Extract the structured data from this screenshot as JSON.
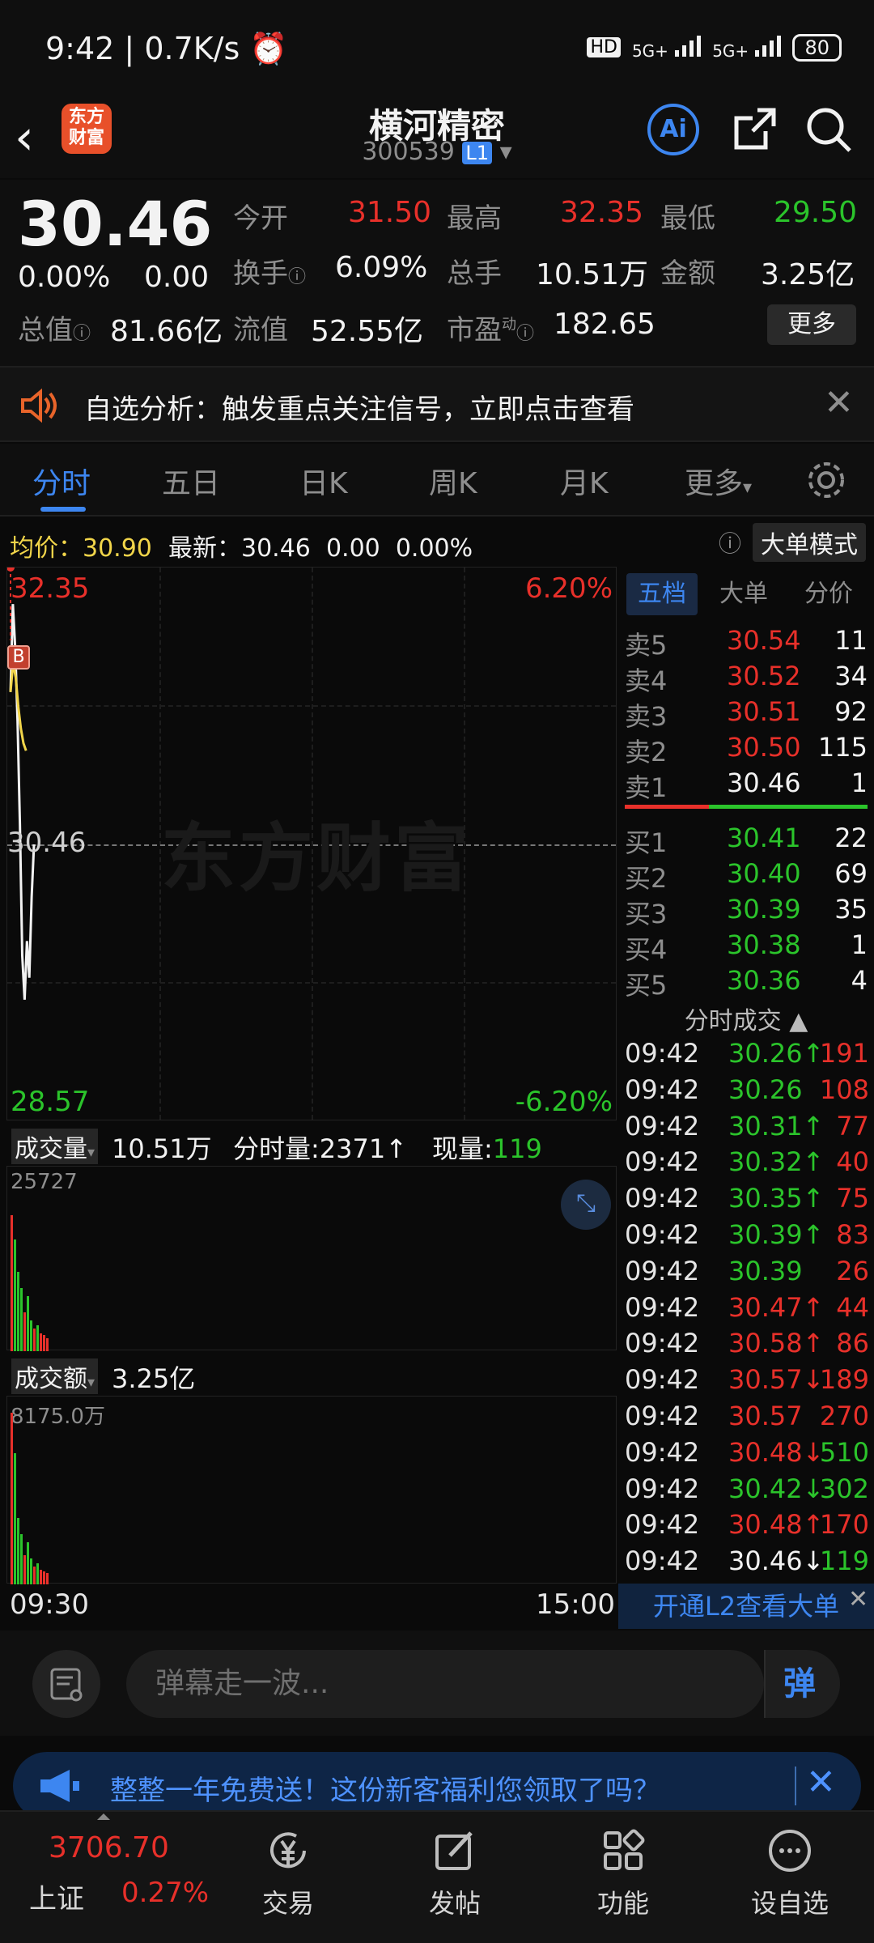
{
  "status_bar": {
    "time": "9:42",
    "speed": "0.7K/s",
    "hd_badge": "HD",
    "net1": "5G+",
    "net2": "5G+",
    "battery": "80"
  },
  "header": {
    "logo_text_top": "东方",
    "logo_text_bottom": "财富",
    "stock_name": "横河精密",
    "stock_code": "300539",
    "level_badge": "L1",
    "ai_label": "Ai"
  },
  "quote": {
    "price": "30.46",
    "change_pct": "0.00%",
    "change_val": "0.00",
    "open_label": "今开",
    "open": "31.50",
    "high_label": "最高",
    "high": "32.35",
    "low_label": "最低",
    "low": "29.50",
    "turnover_label": "换手",
    "turnover": "6.09%",
    "volume_label": "总手",
    "volume": "10.51万",
    "amount_label": "金额",
    "amount": "3.25亿",
    "mktcap_label": "总值",
    "mktcap": "81.66亿",
    "float_label": "流值",
    "float": "52.55亿",
    "pe_label": "市盈",
    "pe_sup": "动",
    "pe": "182.65",
    "more_label": "更多"
  },
  "analysis": {
    "text": "自选分析：触发重点关注信号，立即点击查看"
  },
  "tabs": [
    "分时",
    "五日",
    "日K",
    "周K",
    "月K",
    "更多"
  ],
  "avg": {
    "avg_label": "均价：",
    "avg_value": "30.90",
    "latest_label": "最新：",
    "latest_value": "30.46",
    "chg": "0.00",
    "pct": "0.00%",
    "big_order_mode": "大单模式"
  },
  "chart": {
    "top_price": "32.35",
    "mid_price": "30.46",
    "bottom_price": "28.57",
    "top_pct": "6.20%",
    "bottom_pct": "-6.20%",
    "watermark": "东方财富",
    "marker": "B",
    "time_start": "09:30",
    "time_end": "15:00"
  },
  "chart_data": {
    "type": "line",
    "title": "",
    "ylim": [
      28.57,
      32.35
    ],
    "series": [
      {
        "values": [
          31.5,
          32.1,
          31.8,
          31.3,
          30.6,
          29.7,
          29.4,
          29.8,
          29.55,
          30.1,
          30.46
        ]
      },
      {
        "values": [
          31.5,
          31.7,
          31.6,
          31.4,
          31.25,
          31.15,
          31.1
        ]
      }
    ]
  },
  "volume_panel": {
    "label": "成交量",
    "total": "10.51万",
    "tick_label": "分时量:",
    "tick_value": "2371",
    "now_label": "现量:",
    "now_value": "119",
    "scale_max": "25727"
  },
  "amount_panel": {
    "label": "成交额",
    "total": "3.25亿",
    "scale_max": "8175.0万"
  },
  "orderbook": {
    "tabs": [
      "五档",
      "大单",
      "分价"
    ],
    "asks": [
      {
        "label": "卖5",
        "price": "30.54",
        "vol": "11"
      },
      {
        "label": "卖4",
        "price": "30.52",
        "vol": "34"
      },
      {
        "label": "卖3",
        "price": "30.51",
        "vol": "92"
      },
      {
        "label": "卖2",
        "price": "30.50",
        "vol": "115"
      },
      {
        "label": "卖1",
        "price": "30.46",
        "vol": "1"
      }
    ],
    "bids": [
      {
        "label": "买1",
        "price": "30.41",
        "vol": "22"
      },
      {
        "label": "买2",
        "price": "30.40",
        "vol": "69"
      },
      {
        "label": "买3",
        "price": "30.39",
        "vol": "35"
      },
      {
        "label": "买4",
        "price": "30.38",
        "vol": "1"
      },
      {
        "label": "买5",
        "price": "30.36",
        "vol": "4"
      }
    ],
    "trades_title": "分时成交",
    "trades": [
      {
        "time": "09:42",
        "price": "30.26",
        "arrow": "↑",
        "vol": "191",
        "pc": "green",
        "vc": "red"
      },
      {
        "time": "09:42",
        "price": "30.26",
        "arrow": "",
        "vol": "108",
        "pc": "green",
        "vc": "red"
      },
      {
        "time": "09:42",
        "price": "30.31",
        "arrow": "↑",
        "vol": "77",
        "pc": "green",
        "vc": "red"
      },
      {
        "time": "09:42",
        "price": "30.32",
        "arrow": "↑",
        "vol": "40",
        "pc": "green",
        "vc": "red"
      },
      {
        "time": "09:42",
        "price": "30.35",
        "arrow": "↑",
        "vol": "75",
        "pc": "green",
        "vc": "red"
      },
      {
        "time": "09:42",
        "price": "30.39",
        "arrow": "↑",
        "vol": "83",
        "pc": "green",
        "vc": "red"
      },
      {
        "time": "09:42",
        "price": "30.39",
        "arrow": "",
        "vol": "26",
        "pc": "green",
        "vc": "red"
      },
      {
        "time": "09:42",
        "price": "30.47",
        "arrow": "↑",
        "vol": "44",
        "pc": "red",
        "vc": "red"
      },
      {
        "time": "09:42",
        "price": "30.58",
        "arrow": "↑",
        "vol": "86",
        "pc": "red",
        "vc": "red"
      },
      {
        "time": "09:42",
        "price": "30.57",
        "arrow": "↓",
        "vol": "189",
        "pc": "red",
        "vc": "red"
      },
      {
        "time": "09:42",
        "price": "30.57",
        "arrow": "",
        "vol": "270",
        "pc": "red",
        "vc": "red"
      },
      {
        "time": "09:42",
        "price": "30.48",
        "arrow": "↓",
        "vol": "510",
        "pc": "red",
        "vc": "green"
      },
      {
        "time": "09:42",
        "price": "30.42",
        "arrow": "↓",
        "vol": "302",
        "pc": "green",
        "vc": "green"
      },
      {
        "time": "09:42",
        "price": "30.48",
        "arrow": "↑",
        "vol": "170",
        "pc": "red",
        "vc": "red"
      },
      {
        "time": "09:42",
        "price": "30.46",
        "arrow": "↓",
        "vol": "119",
        "pc": "white",
        "vc": "green"
      }
    ],
    "l2_link": "开通L2查看大单"
  },
  "danmu": {
    "placeholder": "弹幕走一波...",
    "button": "弹"
  },
  "promo": {
    "text": "整整一年免费送！这份新客福利您领取了吗？"
  },
  "bottom_nav": {
    "index_value": "3706.70",
    "index_name": "上证",
    "index_pct": "0.27%",
    "items": [
      "交易",
      "发帖",
      "功能",
      "设自选"
    ]
  },
  "colors": {
    "up": "#e8302a",
    "down": "#2bc42b",
    "accent": "#3d86f0",
    "avg": "#f1d54a"
  }
}
